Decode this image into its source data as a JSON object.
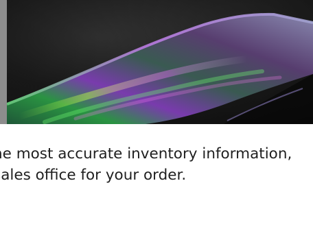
{
  "hero": {
    "image_icon": "holographic-film-icon"
  },
  "notice": {
    "line1": "he most accurate inventory information,",
    "line2": "sales office for your order."
  },
  "colors": {
    "hero_background": "#1f1f1f",
    "left_strip": "#8d8d8d",
    "text": "#1f1f1f",
    "page_background": "#ffffff"
  }
}
